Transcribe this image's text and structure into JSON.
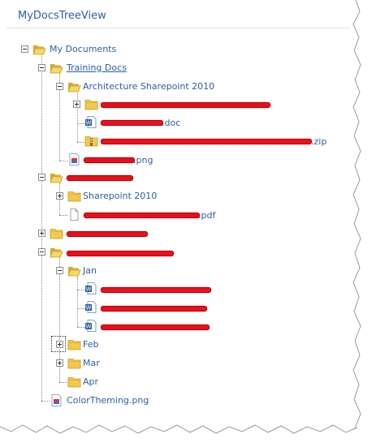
{
  "panel": {
    "title": "MyDocsTreeView"
  },
  "nodes": [
    {
      "id": "my-documents",
      "label": "My Documents",
      "icon": "folder-icon",
      "state": "expanded"
    },
    {
      "id": "training-docs",
      "label": "Training Docs",
      "icon": "folder-icon",
      "state": "expanded",
      "selected": true
    },
    {
      "id": "architecture-sharepoint-2010",
      "label": "Architecture Sharepoint 2010",
      "icon": "folder-icon",
      "state": "expanded"
    },
    {
      "id": "redacted-folder-1",
      "label": "",
      "icon": "folder-icon",
      "state": "collapsed",
      "redacted": true
    },
    {
      "id": "redacted-doc",
      "label": ".doc",
      "icon": "word-document-icon",
      "redacted": true
    },
    {
      "id": "redacted-zip",
      "label": ".zip",
      "icon": "zip-archive-icon",
      "redacted": true
    },
    {
      "id": "redacted-png",
      "label": ".png",
      "icon": "image-file-icon",
      "redacted": true
    },
    {
      "id": "redacted-folder-2",
      "label": "",
      "icon": "folder-icon",
      "state": "expanded",
      "redacted": true
    },
    {
      "id": "sharepoint-2010",
      "label": "Sharepoint 2010",
      "icon": "folder-icon",
      "state": "collapsed"
    },
    {
      "id": "redacted-pdf",
      "label": ".pdf",
      "icon": "blank-file-icon",
      "redacted": true
    },
    {
      "id": "redacted-folder-3",
      "label": "",
      "icon": "folder-icon",
      "state": "collapsed",
      "redacted": true
    },
    {
      "id": "redacted-folder-4",
      "label": "",
      "icon": "folder-icon",
      "state": "expanded",
      "redacted": true
    },
    {
      "id": "jan",
      "label": "Jan",
      "icon": "folder-icon",
      "state": "expanded"
    },
    {
      "id": "jan-doc-1",
      "label": "",
      "icon": "word-document-icon",
      "redacted": true
    },
    {
      "id": "jan-doc-2",
      "label": "",
      "icon": "word-document-icon",
      "redacted": true
    },
    {
      "id": "jan-doc-3",
      "label": "",
      "icon": "word-document-icon",
      "redacted": true
    },
    {
      "id": "feb",
      "label": "Feb",
      "icon": "folder-icon",
      "state": "collapsed",
      "focused": true
    },
    {
      "id": "mar",
      "label": "Mar",
      "icon": "folder-icon",
      "state": "collapsed"
    },
    {
      "id": "apr",
      "label": "Apr",
      "icon": "folder-icon",
      "state": "leaf"
    },
    {
      "id": "color-theming",
      "label": "ColorTheming.png",
      "icon": "image-file-icon"
    }
  ],
  "colors": {
    "link": "#2b5ea8",
    "redaction": "#e8101a",
    "folder": "#f2c94c",
    "word": "#2f5ea8"
  }
}
